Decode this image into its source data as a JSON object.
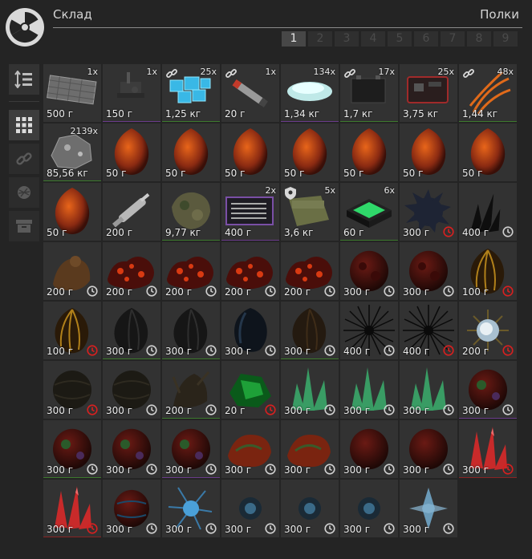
{
  "header": {
    "title": "Склад",
    "shelves_label": "Полки"
  },
  "pages": [
    "1",
    "2",
    "3",
    "4",
    "5",
    "6",
    "7",
    "8",
    "9"
  ],
  "active_page": "1",
  "colors": {
    "green": "#3d7a2e",
    "purple": "#6a3b8a",
    "red": "#8a2323",
    "clock_white": "#d0d0d0",
    "clock_red": "#d82020"
  },
  "sidebar": [
    {
      "name": "sort-button",
      "icon": "sort-icon"
    },
    {
      "name": "grid-view-button",
      "icon": "grid-icon"
    },
    {
      "name": "linked-filter-button",
      "icon": "chain-link-icon"
    },
    {
      "name": "artifact-filter-button",
      "icon": "artifact-icon"
    },
    {
      "name": "archive-button",
      "icon": "archive-box-icon"
    }
  ],
  "items": [
    {
      "art": "crate",
      "qty": "1x",
      "w": "500 г",
      "u": "none"
    },
    {
      "art": "device",
      "qty": "1x",
      "w": "150 г",
      "u": "purple"
    },
    {
      "art": "crystal-blue",
      "qty": "25x",
      "w": "1,25 кг",
      "link": true,
      "u": "green"
    },
    {
      "art": "stick",
      "qty": "1x",
      "w": "20 г",
      "link": true,
      "u": "none"
    },
    {
      "art": "powder",
      "qty": "134x",
      "w": "1,34 кг",
      "u": "purple"
    },
    {
      "art": "battery",
      "qty": "17x",
      "w": "1,7 кг",
      "link": true,
      "u": "green"
    },
    {
      "art": "case",
      "qty": "25x",
      "w": "3,75 кг",
      "u": "none"
    },
    {
      "art": "fern",
      "qty": "48x",
      "w": "1,44 кг",
      "link": true,
      "u": "green"
    },
    {
      "art": "ore",
      "qty": "2139x",
      "w": "85,56 кг",
      "u": "green"
    },
    {
      "art": "onion",
      "w": "50 г",
      "u": "none"
    },
    {
      "art": "onion",
      "w": "50 г",
      "u": "none"
    },
    {
      "art": "onion",
      "w": "50 г",
      "u": "none"
    },
    {
      "art": "onion",
      "w": "50 г",
      "u": "none"
    },
    {
      "art": "onion",
      "w": "50 г",
      "u": "none"
    },
    {
      "art": "onion",
      "w": "50 г",
      "u": "none"
    },
    {
      "art": "onion",
      "w": "50 г",
      "u": "none"
    },
    {
      "art": "onion",
      "w": "50 г",
      "u": "none"
    },
    {
      "art": "multitool",
      "w": "200 г",
      "u": "none"
    },
    {
      "art": "camo",
      "w": "9,77 кг",
      "u": "green"
    },
    {
      "art": "toolcase",
      "qty": "2x",
      "w": "400 г",
      "u": "purple"
    },
    {
      "art": "medbag",
      "qty": "5x",
      "w": "3,6 кг",
      "shield": true,
      "u": "none"
    },
    {
      "art": "greenbox",
      "qty": "6x",
      "w": "60 г",
      "u": "green"
    },
    {
      "art": "spiky-dark",
      "w": "300 г",
      "clock": "red",
      "u": "none"
    },
    {
      "art": "black-crystal",
      "w": "400 г",
      "clock": "white",
      "u": "none"
    },
    {
      "art": "brown-blob",
      "w": "200 г",
      "clock": "white",
      "u": "none"
    },
    {
      "art": "lava-nugget",
      "w": "200 г",
      "clock": "white",
      "u": "none"
    },
    {
      "art": "lava-nugget",
      "w": "200 г",
      "clock": "white",
      "u": "none"
    },
    {
      "art": "lava-nugget",
      "w": "200 г",
      "clock": "white",
      "u": "none"
    },
    {
      "art": "lava-nugget",
      "w": "200 г",
      "clock": "white",
      "u": "none"
    },
    {
      "art": "red-rock",
      "w": "300 г",
      "clock": "white",
      "u": "none"
    },
    {
      "art": "red-rock",
      "w": "300 г",
      "clock": "white",
      "u": "none"
    },
    {
      "art": "gold-pod",
      "w": "100 г",
      "clock": "red",
      "u": "none"
    },
    {
      "art": "gold-pod",
      "w": "100 г",
      "clock": "red",
      "u": "none"
    },
    {
      "art": "dark-pod",
      "w": "300 г",
      "clock": "white",
      "u": "green"
    },
    {
      "art": "dark-pod",
      "w": "300 г",
      "clock": "white",
      "u": "green"
    },
    {
      "art": "shell-blue",
      "w": "300 г",
      "clock": "white",
      "u": "none"
    },
    {
      "art": "brown-pod",
      "w": "300 г",
      "clock": "white",
      "u": "green"
    },
    {
      "art": "urchin",
      "w": "400 г",
      "clock": "white",
      "u": "none"
    },
    {
      "art": "urchin",
      "w": "400 г",
      "clock": "red",
      "u": "none"
    },
    {
      "art": "sun-orb",
      "w": "200 г",
      "clock": "red",
      "u": "none"
    },
    {
      "art": "dark-sphere",
      "w": "300 г",
      "clock": "red",
      "u": "none"
    },
    {
      "art": "dark-sphere",
      "w": "300 г",
      "clock": "white",
      "u": "none"
    },
    {
      "art": "thorn",
      "w": "200 г",
      "clock": "white",
      "u": "green"
    },
    {
      "art": "green-gem",
      "w": "20 г",
      "clock": "red",
      "u": "none"
    },
    {
      "art": "green-crystal",
      "w": "300 г",
      "clock": "white",
      "u": "none"
    },
    {
      "art": "green-crystal",
      "w": "300 г",
      "clock": "white",
      "u": "none"
    },
    {
      "art": "green-crystal",
      "w": "300 г",
      "clock": "white",
      "u": "none"
    },
    {
      "art": "murky-green",
      "w": "300 г",
      "clock": "white",
      "u": "purple"
    },
    {
      "art": "murky-green",
      "w": "300 г",
      "clock": "white",
      "u": "green"
    },
    {
      "art": "murky-green",
      "w": "300 г",
      "clock": "white",
      "u": "none"
    },
    {
      "art": "murky-green",
      "w": "300 г",
      "clock": "white",
      "u": "purple"
    },
    {
      "art": "red-rock-green",
      "w": "300 г",
      "clock": "white",
      "u": "none"
    },
    {
      "art": "red-rock-green",
      "w": "300 г",
      "clock": "white",
      "u": "none"
    },
    {
      "art": "dark-red-orb",
      "w": "300 г",
      "clock": "white",
      "u": "none"
    },
    {
      "art": "dark-red-orb",
      "w": "300 г",
      "clock": "white",
      "u": "none"
    },
    {
      "art": "red-shard",
      "w": "300 г",
      "clock": "red",
      "u": "red"
    },
    {
      "art": "red-shard",
      "w": "300 г",
      "clock": "red",
      "u": "red"
    },
    {
      "art": "blue-orb",
      "w": "300 г",
      "clock": "white",
      "u": "none"
    },
    {
      "art": "blue-splash",
      "w": "300 г",
      "clock": "white",
      "u": "none"
    },
    {
      "art": "dim-blue",
      "w": "300 г",
      "clock": "white",
      "u": "none"
    },
    {
      "art": "dim-blue",
      "w": "300 г",
      "clock": "white",
      "u": "none"
    },
    {
      "art": "dim-blue",
      "w": "300 г",
      "clock": "white",
      "u": "none"
    },
    {
      "art": "pale-blue",
      "w": "300 г",
      "clock": "white",
      "u": "none"
    }
  ]
}
